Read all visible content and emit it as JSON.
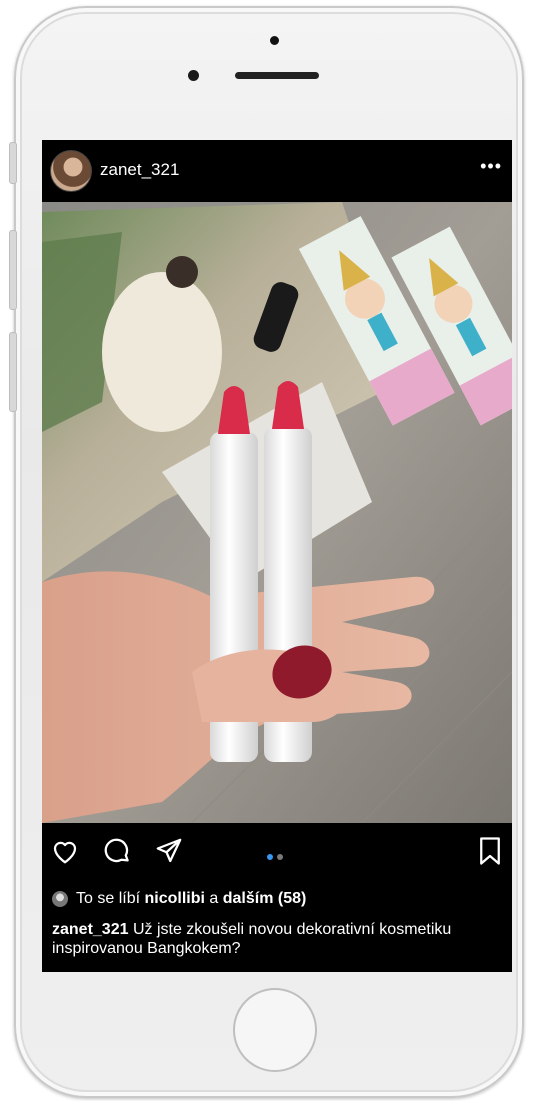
{
  "post": {
    "username": "zanet_321",
    "more_glyph": "•••",
    "likes": {
      "prefix": "To se líbí",
      "liker": "nicollibi",
      "conjunction": "a",
      "others": "dalším (58)"
    },
    "caption": {
      "author": "zanet_321",
      "text": "Už jste zkoušeli novou dekorativní kosmetiku inspirovanou Bangkokem?"
    },
    "carousel": {
      "count": 2,
      "active_index": 0
    }
  },
  "icons": {
    "like": "heart-icon",
    "comment": "comment-bubble-icon",
    "share": "paper-plane-icon",
    "save": "bookmark-icon",
    "more": "more-dots-icon"
  },
  "colors": {
    "screen_bg": "#000000",
    "text": "#ffffff",
    "active_dot": "#3897f0",
    "inactive_dot": "#7a7a7a",
    "lipstick": "#d92b4a",
    "nail": "#8e1a2c"
  }
}
